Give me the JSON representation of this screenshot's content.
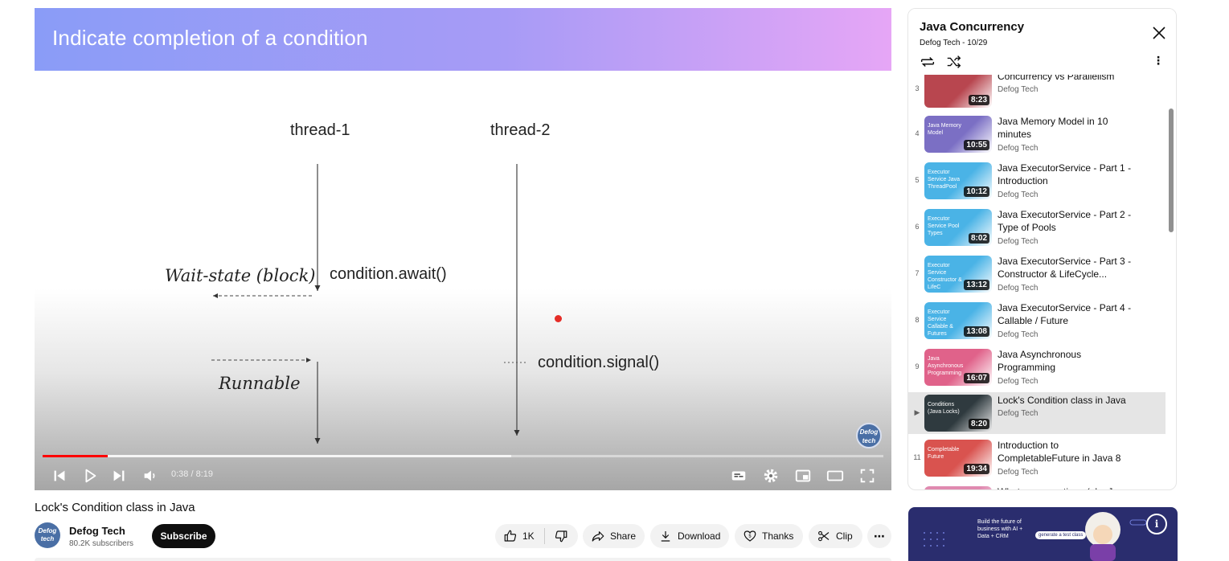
{
  "slide": {
    "title": "Indicate completion of a condition",
    "thread1": "thread-1",
    "thread2": "thread-2",
    "await": "condition.await()",
    "signal": "condition.signal()",
    "wait_state": "Wait-state (block)",
    "runnable": "Runnable",
    "watermark": "Defog tech"
  },
  "player": {
    "time": "0:38 / 8:19",
    "progress_played": 0.077,
    "progress_buffered": 0.557
  },
  "video": {
    "title": "Lock's Condition class in Java",
    "channel": "Defog Tech",
    "subscribers": "80.2K subscribers",
    "subscribe_label": "Subscribe",
    "avatar_text": "Defog tech",
    "likes": "1K",
    "share": "Share",
    "download": "Download",
    "thanks": "Thanks",
    "clip": "Clip"
  },
  "playlist": {
    "title": "Java Concurrency",
    "subtitle": "Defog Tech - 10/29",
    "items": [
      {
        "index": "3",
        "title": "Concurrency vs Parallelism",
        "channel": "Defog Tech",
        "duration": "8:23",
        "thumb_color": "#b8464f",
        "caption": "",
        "current": false
      },
      {
        "index": "4",
        "title": "Java Memory Model in 10 minutes",
        "channel": "Defog Tech",
        "duration": "10:55",
        "thumb_color": "#7b6fc4",
        "caption": "Java Memory Model",
        "current": false
      },
      {
        "index": "5",
        "title": "Java ExecutorService - Part 1 - Introduction",
        "channel": "Defog Tech",
        "duration": "10:12",
        "thumb_color": "#4ab3e6",
        "caption": "Executor Service Java ThreadPool",
        "current": false
      },
      {
        "index": "6",
        "title": "Java ExecutorService - Part 2 - Type of Pools",
        "channel": "Defog Tech",
        "duration": "8:02",
        "thumb_color": "#4ab3e6",
        "caption": "Executor Service Pool Types",
        "current": false
      },
      {
        "index": "7",
        "title": "Java ExecutorService - Part 3 - Constructor & LifeCycle...",
        "channel": "Defog Tech",
        "duration": "13:12",
        "thumb_color": "#4ab3e6",
        "caption": "Executor Service Constructor & LifeC",
        "current": false
      },
      {
        "index": "8",
        "title": "Java ExecutorService - Part 4 - Callable / Future",
        "channel": "Defog Tech",
        "duration": "13:08",
        "thumb_color": "#4ab3e6",
        "caption": "Executor Service Callable & Futures",
        "current": false
      },
      {
        "index": "9",
        "title": "Java Asynchronous Programming",
        "channel": "Defog Tech",
        "duration": "16:07",
        "thumb_color": "#e0628a",
        "caption": "Java Asynchronous Programming",
        "current": false
      },
      {
        "index": "▶",
        "title": "Lock's Condition class in Java",
        "channel": "Defog Tech",
        "duration": "8:20",
        "thumb_color": "#2f3a3f",
        "caption": "Conditions (Java Locks)",
        "current": true
      },
      {
        "index": "11",
        "title": "Introduction to CompletableFuture in Java 8",
        "channel": "Defog Tech",
        "duration": "19:34",
        "thumb_color": "#d9534f",
        "caption": "Completable Future",
        "current": false
      },
      {
        "index": "",
        "title": "What are coroutines (aka Java",
        "channel": "",
        "duration": "",
        "thumb_color": "#e08ab0",
        "caption": "",
        "current": false
      }
    ]
  },
  "ad": {
    "text": "Build the future of business with AI + Data + CRM",
    "cta": "generate a test class",
    "info": "i"
  }
}
